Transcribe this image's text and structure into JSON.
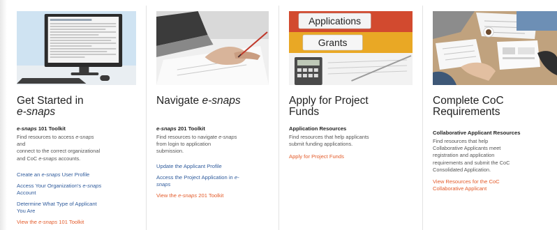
{
  "colors": {
    "link_blue": "#2f5b9c",
    "link_orange": "#e35b2a",
    "heading": "#222222",
    "body_text": "#555555"
  },
  "cards": [
    {
      "image": "computer-monitor-image",
      "title_a": "Get Started in",
      "title_b": "e-snaps",
      "subhead_em": "e-snaps",
      "subhead_rest": " 101 Toolkit",
      "desc_1a": "Find resources to access ",
      "desc_1b": "e-snaps",
      "desc_2": "and",
      "desc_3": "connect to the correct organizational",
      "desc_4a": "and CoC ",
      "desc_4b": "e-snaps",
      "desc_4c": " accounts.",
      "link1_a": "Create an ",
      "link1_b": "e-snaps",
      "link1_c": " User Profile",
      "link2_a": "Access Your Organization's ",
      "link2_b": "e-snaps",
      "link2_c": "Account",
      "link3_a": "Determine What Type of Applicant",
      "link3_b": "You Are",
      "link4_a": "View the ",
      "link4_b": "e-snaps",
      "link4_c": " 101 Toolkit"
    },
    {
      "image": "hand-writing-laptop-image",
      "title_a": "Navigate ",
      "title_b": "e-snaps",
      "subhead_em": "e-snaps",
      "subhead_rest": " 201 Toolkit",
      "desc_1a": "Find resources to navigate ",
      "desc_1b": "e-snaps",
      "desc_2": "from login to application",
      "desc_3": "submission.",
      "link1": "Update the Applicant Profile",
      "link2_a": "Access the Project Application in ",
      "link2_b": "e-",
      "link2_c": "snaps",
      "link3_a": "View the ",
      "link3_b": "e-snaps",
      "link3_c": " 201 Toolkit"
    },
    {
      "image": "binders-applications-grants-image",
      "binder_label_1": "Applications",
      "binder_label_2": "Grants",
      "title_a": "Apply for Project",
      "title_b": "Funds",
      "subhead": "Application Resources",
      "desc_1": "Find resources that help applicants",
      "desc_2": "submit funding applications.",
      "link1": "Apply for Project Funds"
    },
    {
      "image": "team-meeting-table-image",
      "title_a": "Complete CoC",
      "title_b": "Requirements",
      "subhead": "Collaborative Applicant Resources",
      "desc_1": "Find resources that help",
      "desc_2": "Collaborative Applicants meet",
      "desc_3": "registration and application",
      "desc_4": "requirements and submit the CoC",
      "desc_5": "Consolidated Application.",
      "link1_a": "View Resources for the CoC",
      "link1_b": "Collaborative Applicant"
    }
  ]
}
